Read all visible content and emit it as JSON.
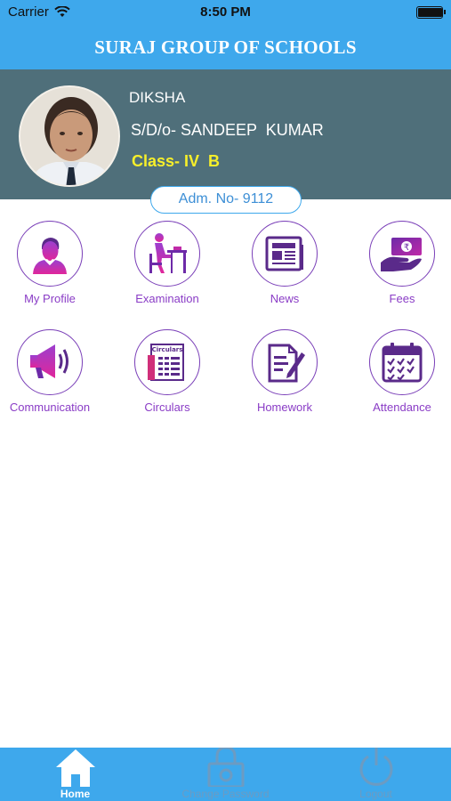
{
  "status_bar": {
    "carrier": "Carrier",
    "time": "8:50 PM",
    "battery_level": 0.95
  },
  "header": {
    "title": "SURAJ GROUP OF SCHOOLS"
  },
  "profile": {
    "name": "DIKSHA",
    "parent": "S/D/o- SANDEEP  KUMAR",
    "class": "Class- IV  B",
    "admission": "Adm. No- 9112"
  },
  "menu": {
    "items": [
      {
        "label": "My Profile",
        "icon": "user-icon"
      },
      {
        "label": "Examination",
        "icon": "exam-desk-icon"
      },
      {
        "label": "News",
        "icon": "newspaper-icon"
      },
      {
        "label": "Fees",
        "icon": "cash-hand-icon"
      },
      {
        "label": "Communication",
        "icon": "megaphone-icon"
      },
      {
        "label": "Circulars",
        "icon": "circulars-icon",
        "icon_text": "Circulars"
      },
      {
        "label": "Homework",
        "icon": "homework-icon"
      },
      {
        "label": "Attendance",
        "icon": "calendar-icon"
      }
    ]
  },
  "tab_bar": {
    "tabs": [
      {
        "label": "Home",
        "icon": "home-icon",
        "active": true
      },
      {
        "label": "Change Password",
        "icon": "lock-icon",
        "active": false
      },
      {
        "label": "Logout",
        "icon": "power-icon",
        "active": false
      }
    ]
  },
  "colors": {
    "primary": "#3ea8ec",
    "profile_band": "#4f6f7a",
    "accent_purple": "#8a3cc6",
    "class_yellow": "#f7ef2a"
  }
}
